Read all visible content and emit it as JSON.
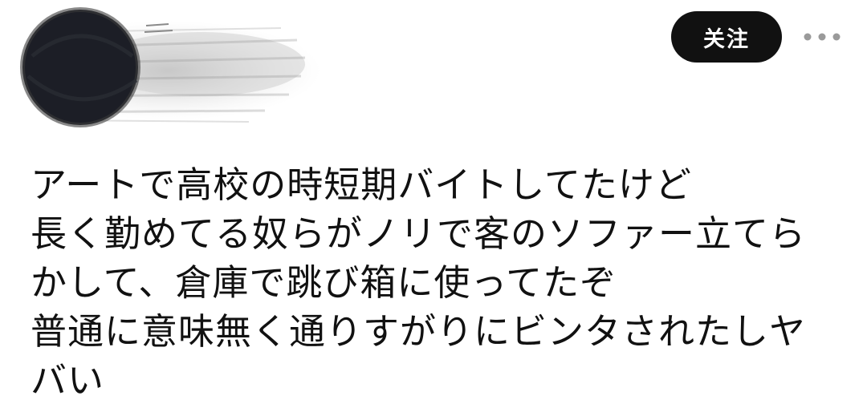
{
  "header": {
    "follow_label": "关注"
  },
  "icons": {
    "avatar": "scribbled-avatar",
    "more": "more-horizontal-icon"
  },
  "post": {
    "lines": [
      "アートで高校の時短期バイトしてたけど",
      "長く勤めてる奴らがノリで客のソファー立てら",
      "かして、倉庫で跳び箱に使ってたぞ",
      "普通に意味無く通りすがりにビンタされたしヤ",
      "バい"
    ]
  },
  "colors": {
    "button_bg": "#111111",
    "button_text": "#ffffff",
    "text": "#111111",
    "more_dots": "#9a9a9a"
  }
}
